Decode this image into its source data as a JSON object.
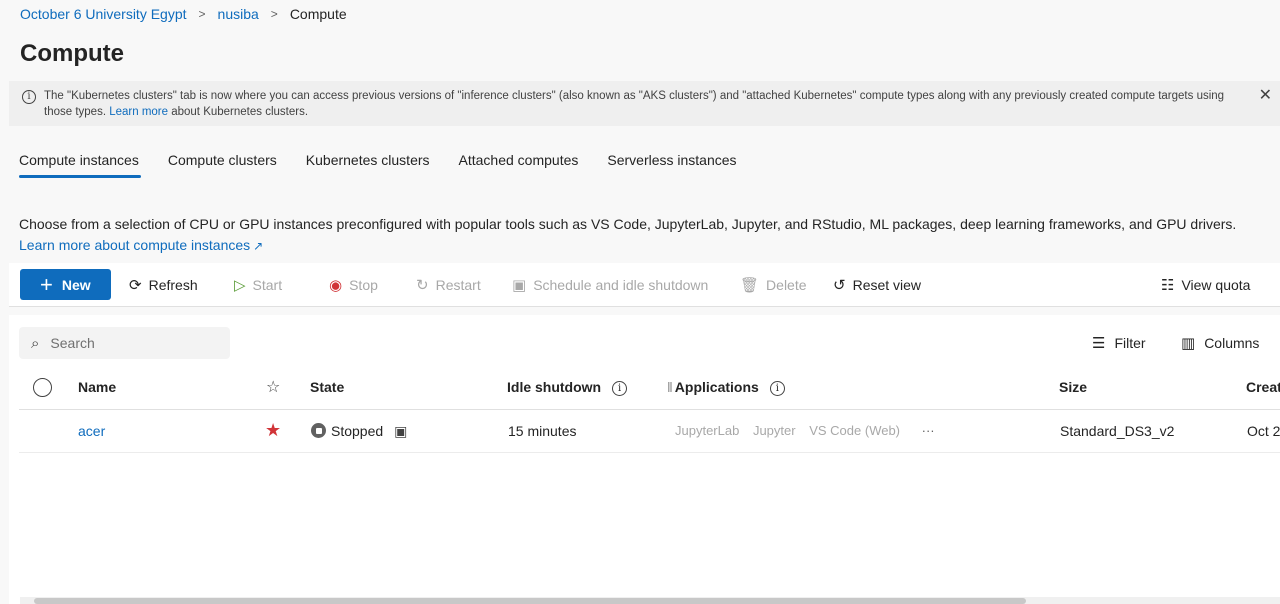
{
  "breadcrumb": {
    "items": [
      "October 6 University Egypt",
      "nusiba",
      "Compute"
    ]
  },
  "page_title": "Compute",
  "notice": {
    "text_before": "The \"Kubernetes clusters\" tab is now where you can access previous versions of \"inference clusters\" (also known as \"AKS clusters\") and \"attached Kubernetes\" compute types along with any previously created compute targets using those types. ",
    "link": "Learn more",
    "text_after": " about Kubernetes clusters.",
    "info_glyph": "i",
    "close_glyph": "✕"
  },
  "tabs": [
    {
      "label": "Compute instances",
      "active": true
    },
    {
      "label": "Compute clusters"
    },
    {
      "label": "Kubernetes clusters"
    },
    {
      "label": "Attached computes"
    },
    {
      "label": "Serverless instances"
    }
  ],
  "description": {
    "text": "Choose from a selection of CPU or GPU instances preconfigured with popular tools such as VS Code, JupyterLab, Jupyter, and RStudio, ML packages, deep learning frameworks, and GPU drivers. ",
    "link": "Learn more about compute instances",
    "link_icon": "↗"
  },
  "toolbar": {
    "new": {
      "label": "New",
      "icon": "+"
    },
    "refresh": {
      "label": "Refresh",
      "icon": "⟳"
    },
    "start": {
      "label": "Start",
      "icon": "▷"
    },
    "stop": {
      "label": "Stop",
      "icon": "◉"
    },
    "restart": {
      "label": "Restart",
      "icon": "↻"
    },
    "schedule": {
      "label": "Schedule and idle shutdown",
      "icon": "▣"
    },
    "delete": {
      "label": "Delete",
      "icon": "🗑"
    },
    "reset": {
      "label": "Reset view",
      "icon": "↺"
    },
    "view_quota": {
      "label": "View quota",
      "icon": "☷"
    }
  },
  "list": {
    "search_placeholder": "Search",
    "search_icon": "⌕",
    "filter_label": "Filter",
    "filter_icon": "☰",
    "columns_label": "Columns",
    "columns_icon": "▥",
    "headers": {
      "name": "Name",
      "favorite": "☆",
      "state": "State",
      "idle_shutdown": "Idle shutdown",
      "applications": "Applications",
      "size": "Size",
      "created": "Creat",
      "info_glyph": "i"
    },
    "rows": [
      {
        "name": "acer",
        "favorite": "★",
        "state": "Stopped",
        "schedule_icon": "▣",
        "idle_shutdown": "15 minutes",
        "applications": [
          "JupyterLab",
          "Jupyter",
          "VS Code (Web)"
        ],
        "more": "···",
        "size": "Standard_DS3_v2",
        "created": "Oct 2"
      }
    ]
  },
  "colors": {
    "accent": "#0f6cbd",
    "favorite_star": "#d13438",
    "disabled_text": "#a8a8a8"
  }
}
